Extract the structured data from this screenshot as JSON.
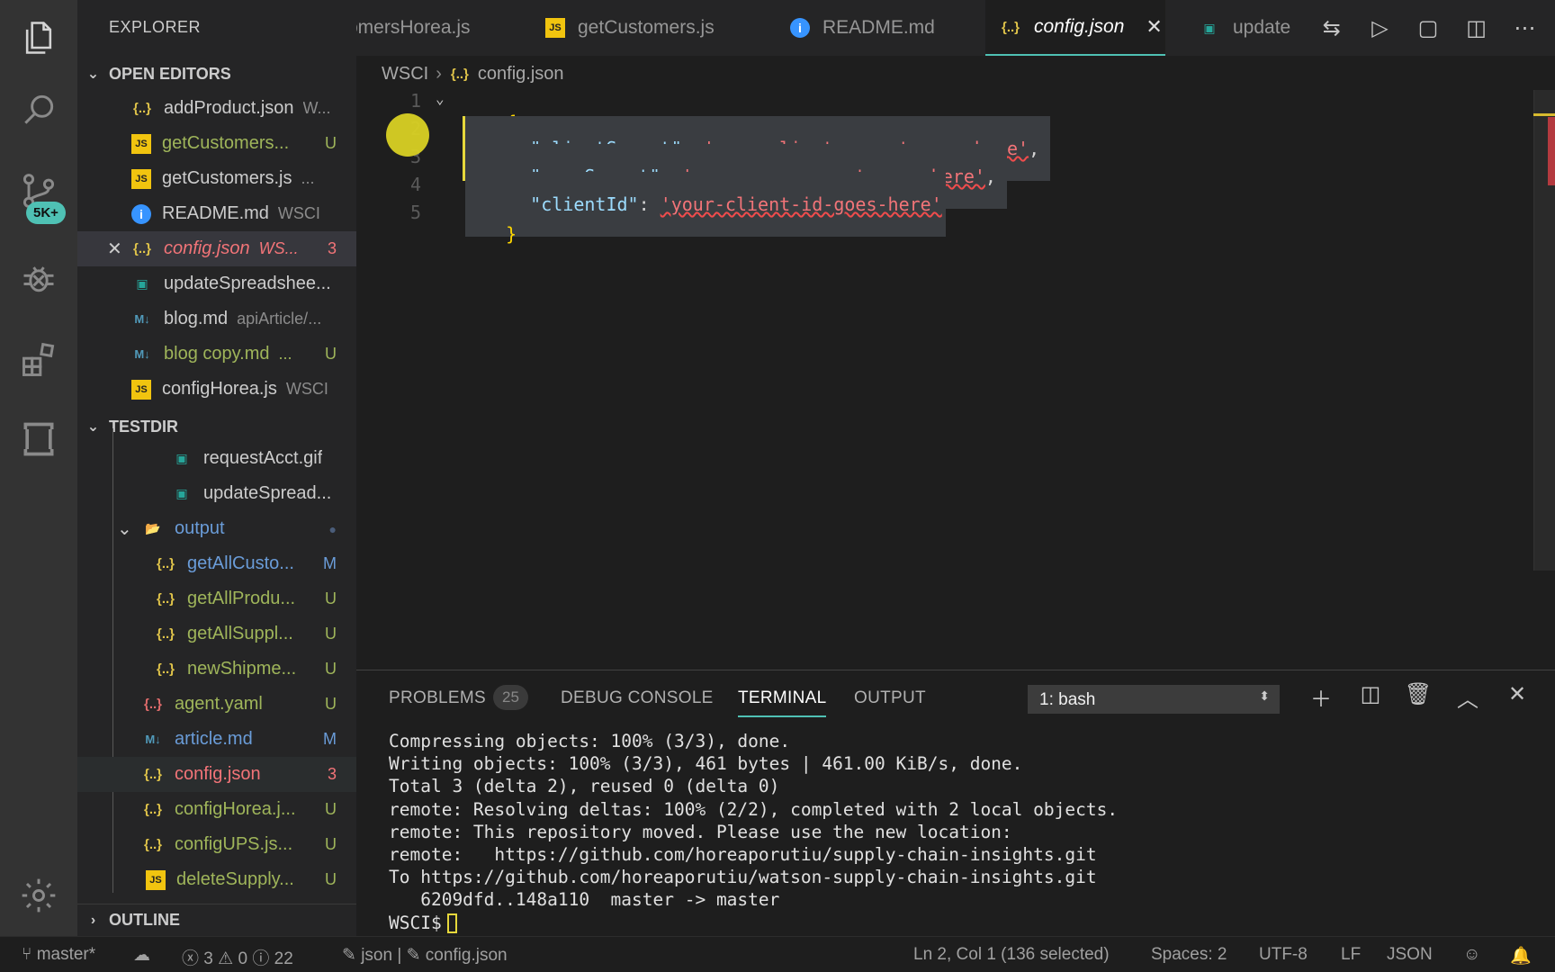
{
  "activity_bar": {
    "icons": [
      "explorer-icon",
      "search-icon",
      "source-control-icon",
      "debug-icon",
      "extensions-icon",
      "remote-icon",
      "settings-gear-icon"
    ],
    "source_control_badge": "5K+"
  },
  "sidebar": {
    "title": "EXPLORER",
    "open_editors": {
      "header": "OPEN EDITORS",
      "items": [
        {
          "icon": "{..}",
          "name": "addProduct.json",
          "desc": "W...",
          "status": ""
        },
        {
          "icon": "JS",
          "name": "getCustomers...",
          "desc": "",
          "status": "U"
        },
        {
          "icon": "JS",
          "name": "getCustomers.js",
          "desc": "...",
          "status": ""
        },
        {
          "icon": "i",
          "name": "README.md",
          "desc": "WSCI",
          "status": ""
        },
        {
          "icon": "{..}",
          "name": "config.json",
          "desc": "WS...",
          "status": "3"
        },
        {
          "icon": "img",
          "name": "updateSpreadshee...",
          "desc": "",
          "status": ""
        },
        {
          "icon": "M↓",
          "name": "blog.md",
          "desc": "apiArticle/...",
          "status": ""
        },
        {
          "icon": "M↓",
          "name": "blog copy.md",
          "desc": "...",
          "status": "U"
        },
        {
          "icon": "JS",
          "name": "configHorea.js",
          "desc": "WSCI",
          "status": ""
        }
      ]
    },
    "testdir": {
      "header": "TESTDIR",
      "items": [
        {
          "icon": "img",
          "name": "requestAcct.gif",
          "status": ""
        },
        {
          "icon": "img",
          "name": "updateSpread...",
          "status": ""
        },
        {
          "icon": "folder",
          "name": "output",
          "status": "●"
        },
        {
          "icon": "{..}",
          "name": "getAllCusto...",
          "status": "M"
        },
        {
          "icon": "{..}",
          "name": "getAllProdu...",
          "status": "U"
        },
        {
          "icon": "{..}",
          "name": "getAllSuppl...",
          "status": "U"
        },
        {
          "icon": "{..}",
          "name": "newShipme...",
          "status": "U"
        },
        {
          "icon": "{..}",
          "name": "agent.yaml",
          "status": "U"
        },
        {
          "icon": "M↓",
          "name": "article.md",
          "status": "M"
        },
        {
          "icon": "{..}",
          "name": "config.json",
          "status": "3"
        },
        {
          "icon": "{..}",
          "name": "configHorea.j...",
          "status": "U"
        },
        {
          "icon": "{..}",
          "name": "configUPS.js...",
          "status": "U"
        },
        {
          "icon": "JS",
          "name": "deleteSupply...",
          "status": "U"
        }
      ]
    },
    "outline_header": "OUTLINE"
  },
  "tabs": [
    {
      "icon": "",
      "label": "omersHorea.js"
    },
    {
      "icon": "JS",
      "label": "getCustomers.js"
    },
    {
      "icon": "i",
      "label": "README.md"
    },
    {
      "icon": "{..}",
      "label": "config.json"
    },
    {
      "icon": "img",
      "label": "update"
    }
  ],
  "tab_actions": [
    "open-changes-icon",
    "run-icon",
    "toggle-view-icon",
    "split-editor-icon",
    "more-actions-icon"
  ],
  "breadcrumb": {
    "root": "WSCI",
    "icon": "{..}",
    "file": "config.json"
  },
  "editor": {
    "line_numbers": [
      "1",
      "2",
      "3",
      "4",
      "5"
    ],
    "lines": [
      {
        "open": "{"
      },
      {
        "key": "\"clientSecret\"",
        "colon": ": ",
        "value": "'your-client-secret-goes-here'",
        "trail": ","
      },
      {
        "key": "\"userSecret\"",
        "colon": ": ",
        "value": "'your-user-secret-goes-here'",
        "trail": ","
      },
      {
        "key": "\"clientId\"",
        "colon": ": ",
        "value": "'your-client-id-goes-here'",
        "trail": ""
      },
      {
        "close": "}"
      }
    ]
  },
  "panel": {
    "tabs": [
      "PROBLEMS",
      "DEBUG CONSOLE",
      "TERMINAL",
      "OUTPUT"
    ],
    "problem_count": "25",
    "shell": "1: bash",
    "terminal_lines": [
      "Compressing objects: 100% (3/3), done.",
      "Writing objects: 100% (3/3), 461 bytes | 461.00 KiB/s, done.",
      "Total 3 (delta 2), reused 0 (delta 0)",
      "remote: Resolving deltas: 100% (2/2), completed with 2 local objects.",
      "remote: This repository moved. Please use the new location:",
      "remote:   https://github.com/horeaporutiu/supply-chain-insights.git",
      "To https://github.com/horeaporutiu/watson-supply-chain-insights.git",
      "   6209dfd..148a110  master -> master"
    ],
    "prompt": "WSCI$"
  },
  "statusbar": {
    "branch": "master*",
    "errors": "3",
    "warnings": "0",
    "infos": "22",
    "language_crumb": "json",
    "file_crumb": "config.json",
    "position": "Ln 2, Col 1 (136 selected)",
    "spaces": "Spaces: 2",
    "encoding": "UTF-8",
    "eol": "LF",
    "language": "JSON"
  },
  "colors": {
    "accent": "#4fc1b4",
    "error": "#f27478",
    "untracked": "#9fb55a",
    "modified": "#6a9cd8"
  }
}
